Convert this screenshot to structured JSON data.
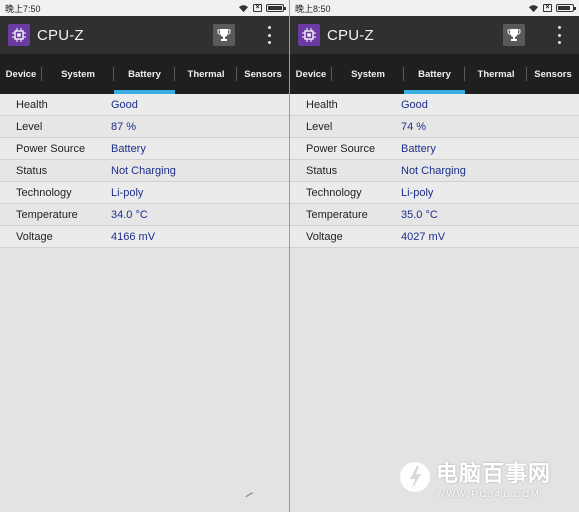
{
  "colors": {
    "appbar": "#303030",
    "tabbar": "#1f1f1f",
    "tab_indicator": "#38aede",
    "value_text": "#1d2e8a",
    "logo": "#6b3aa3"
  },
  "panels": [
    {
      "status": {
        "time": "晚上7:50",
        "battery_level": 0.9
      },
      "app": {
        "title": "CPU-Z",
        "logo_icon": "cpu-chip-icon",
        "action_icon": "trophy-icon",
        "menu_icon": "overflow-menu-icon"
      },
      "tabs": [
        {
          "label": "Device"
        },
        {
          "label": "System"
        },
        {
          "label": "Battery",
          "active": true
        },
        {
          "label": "Thermal"
        },
        {
          "label": "Sensors"
        }
      ],
      "rows": [
        {
          "label": "Health",
          "value": "Good"
        },
        {
          "label": "Level",
          "value": "87 %"
        },
        {
          "label": "Power Source",
          "value": "Battery"
        },
        {
          "label": "Status",
          "value": "Not Charging"
        },
        {
          "label": "Technology",
          "value": "Li-poly"
        },
        {
          "label": "Temperature",
          "value": "34.0 °C"
        },
        {
          "label": "Voltage",
          "value": "4166 mV"
        }
      ]
    },
    {
      "status": {
        "time": "晚上8:50",
        "battery_level": 0.75
      },
      "app": {
        "title": "CPU-Z",
        "logo_icon": "cpu-chip-icon",
        "action_icon": "trophy-icon",
        "menu_icon": "overflow-menu-icon"
      },
      "tabs": [
        {
          "label": "Device"
        },
        {
          "label": "System"
        },
        {
          "label": "Battery",
          "active": true
        },
        {
          "label": "Thermal"
        },
        {
          "label": "Sensors"
        }
      ],
      "rows": [
        {
          "label": "Health",
          "value": "Good"
        },
        {
          "label": "Level",
          "value": "74 %"
        },
        {
          "label": "Power Source",
          "value": "Battery"
        },
        {
          "label": "Status",
          "value": "Not Charging"
        },
        {
          "label": "Technology",
          "value": "Li-poly"
        },
        {
          "label": "Temperature",
          "value": "35.0 °C"
        },
        {
          "label": "Voltage",
          "value": "4027 mV"
        }
      ]
    }
  ],
  "watermark": {
    "name": "电脑百事网",
    "url": "WWW.PC841.COM",
    "icon": "pc841-logo-icon"
  }
}
